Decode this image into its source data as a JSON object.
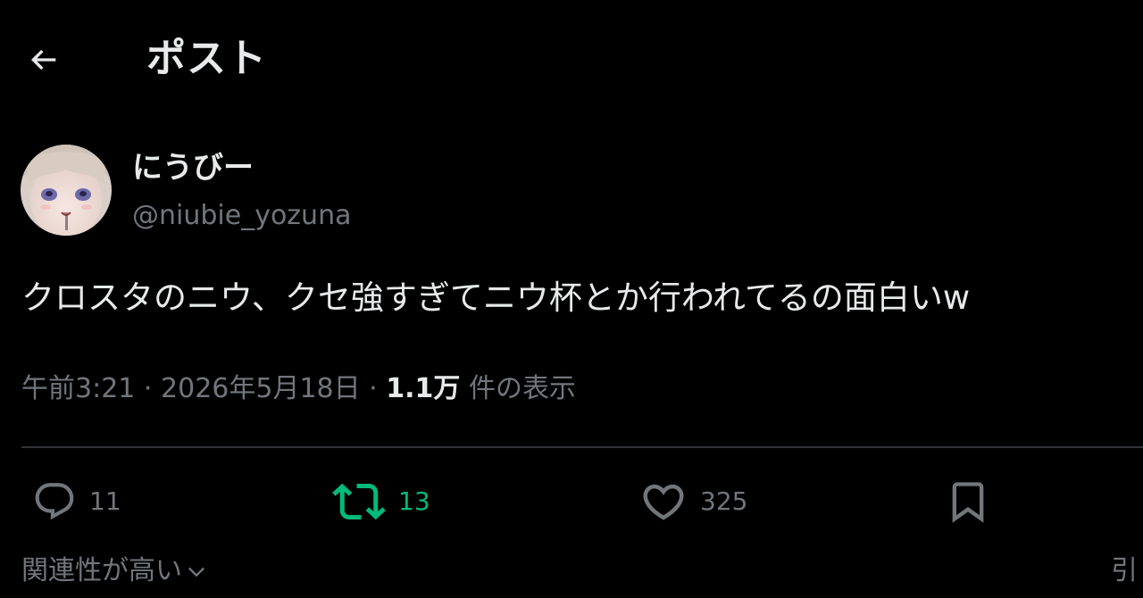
{
  "header": {
    "title": "ポスト",
    "back_icon": "arrow-left-icon"
  },
  "author": {
    "display_name": "にうびー",
    "handle": "@niubie_yozuna",
    "avatar": "anime-character-avatar"
  },
  "tweet": {
    "text": "クロスタのニウ、クセ強すぎてニウ杯とか行われてるの面白いw",
    "time": "午前3:21",
    "separator": "·",
    "date": "2026年5月18日",
    "views_count": "1.1万",
    "views_label": "件の表示"
  },
  "actions": {
    "reply": {
      "icon": "reply-bubble-icon",
      "count": "11"
    },
    "retweet": {
      "icon": "retweet-icon",
      "count": "13"
    },
    "like": {
      "icon": "heart-icon",
      "count": "325"
    },
    "bookmark": {
      "icon": "bookmark-icon"
    }
  },
  "replies_sort": {
    "label": "関連性が高い",
    "icon": "chevron-down-icon",
    "right_partial": "引"
  },
  "colors": {
    "background": "#000000",
    "text_primary": "#e7e9ea",
    "text_secondary": "#71767b",
    "retweet_green": "#00ba7c",
    "divider": "#2f3336"
  }
}
